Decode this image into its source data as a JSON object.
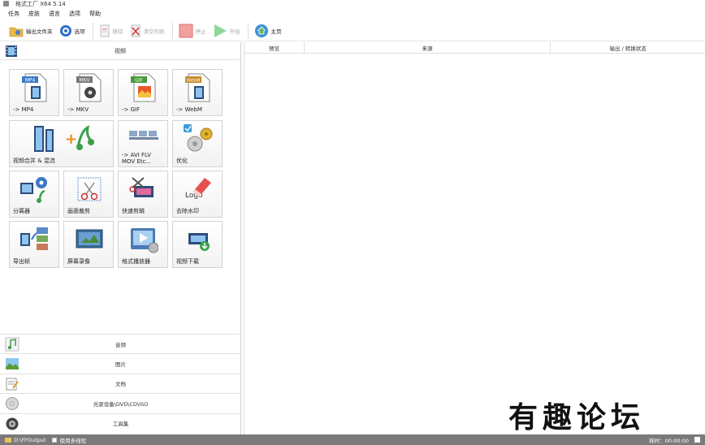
{
  "window": {
    "title": "格式工厂 X64 5.14"
  },
  "menu": {
    "items": [
      "任务",
      "皮肤",
      "语言",
      "选项",
      "帮助"
    ]
  },
  "toolbar": {
    "output_folder": "输出文件夹",
    "options": "选项",
    "remove": "移除",
    "clear_list": "清空列表",
    "stop": "停止",
    "start": "开始",
    "home": "主页"
  },
  "left": {
    "video_section": "视频",
    "tiles": [
      {
        "label": "-> MP4",
        "badge": "MP4"
      },
      {
        "label": "-> MKV",
        "badge": "MKV"
      },
      {
        "label": "-> GIF",
        "badge": "GIF"
      },
      {
        "label": "-> WebM",
        "badge": "WebM"
      },
      {
        "label": "视频合并 & 混流"
      },
      {
        "label": "-> AVI FLV\nMOV Etc..."
      },
      {
        "label": "优化"
      },
      {
        "label": "分离器"
      },
      {
        "label": "画面裁剪"
      },
      {
        "label": "快速剪辑"
      },
      {
        "label": "去除水印",
        "badge": "Logo"
      },
      {
        "label": "导出帧"
      },
      {
        "label": "屏幕录像"
      },
      {
        "label": "格式播放器"
      },
      {
        "label": "视频下载"
      }
    ],
    "bottom_sections": [
      "音频",
      "图片",
      "文档",
      "光驱设备\\DVD\\CD\\ISO",
      "工具集"
    ]
  },
  "table": {
    "columns": [
      "预览",
      "来源",
      "输出 / 转换状态"
    ]
  },
  "status": {
    "output_path": "D:\\FFOutput",
    "multithread": "使用多线程",
    "elapsed": "耗时：00:00:00"
  },
  "watermark": "有趣论坛",
  "colors": {
    "accent_red": "#e03030",
    "play_green": "#3cbf4a",
    "status_bg": "#7a7a7a"
  }
}
